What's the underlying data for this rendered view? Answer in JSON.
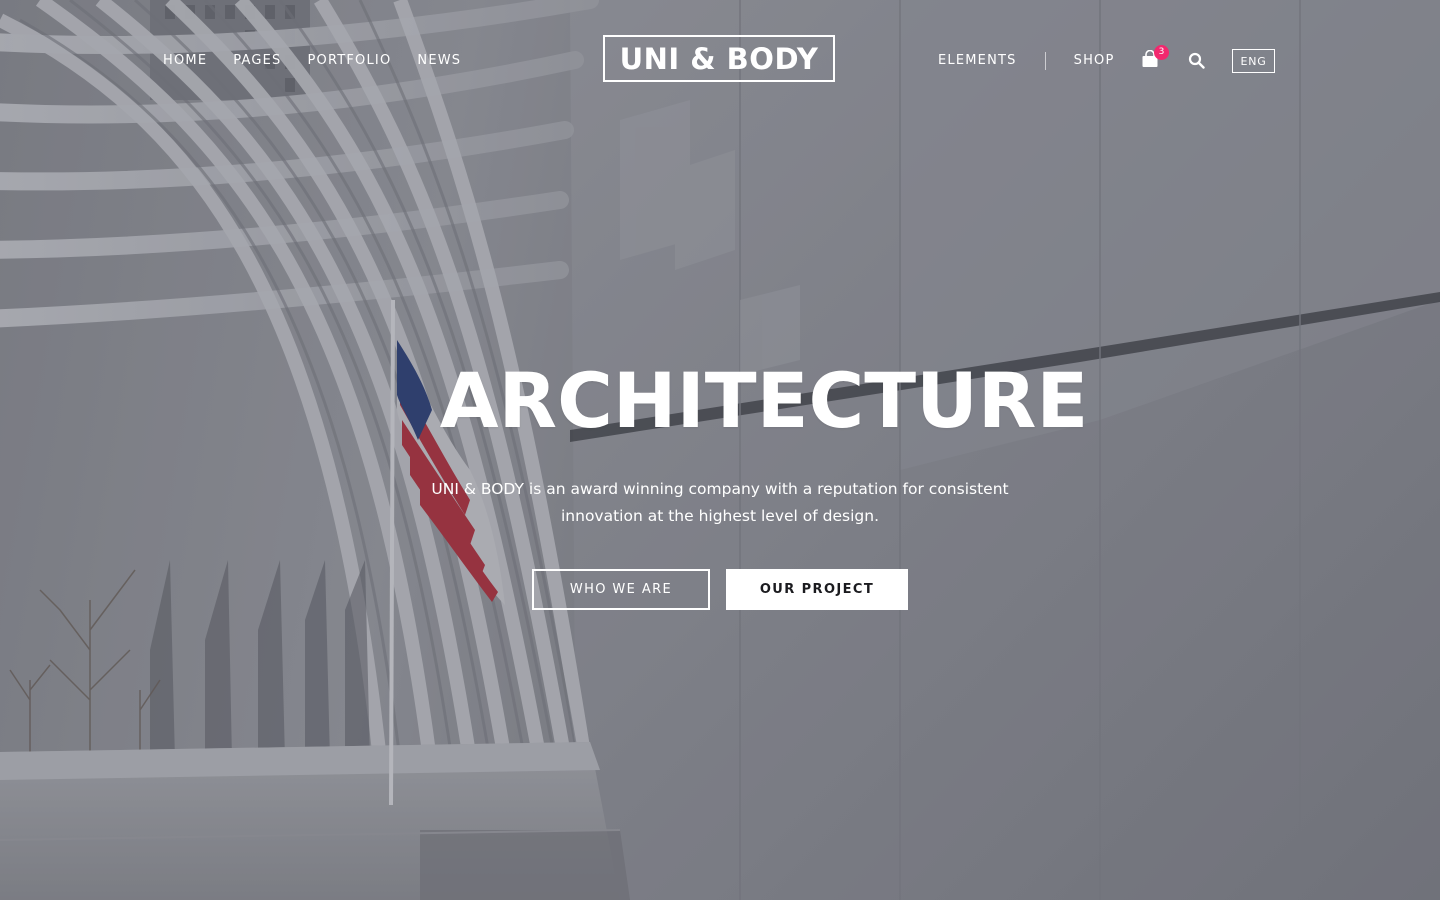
{
  "header": {
    "nav_left": [
      "HOME",
      "PAGES",
      "PORTFOLIO",
      "NEWS"
    ],
    "logo": "UNI & BODY",
    "nav_right": {
      "elements": "ELEMENTS",
      "shop": "SHOP"
    },
    "cart_count": "3",
    "language": "ENG"
  },
  "hero": {
    "title": "ARCHITECTURE",
    "description_line1": "UNI & BODY is an award winning company with a reputation for consistent",
    "description_line2": "innovation at the highest level of design.",
    "buttons": {
      "primary": "WHO WE ARE",
      "secondary": "OUR PROJECT"
    }
  },
  "colors": {
    "accent": "#f2286e",
    "text": "#ffffff",
    "button_dark_text": "#1b1b1f"
  },
  "icons": {
    "cart": "shopping-bag-icon",
    "search": "search-icon"
  }
}
